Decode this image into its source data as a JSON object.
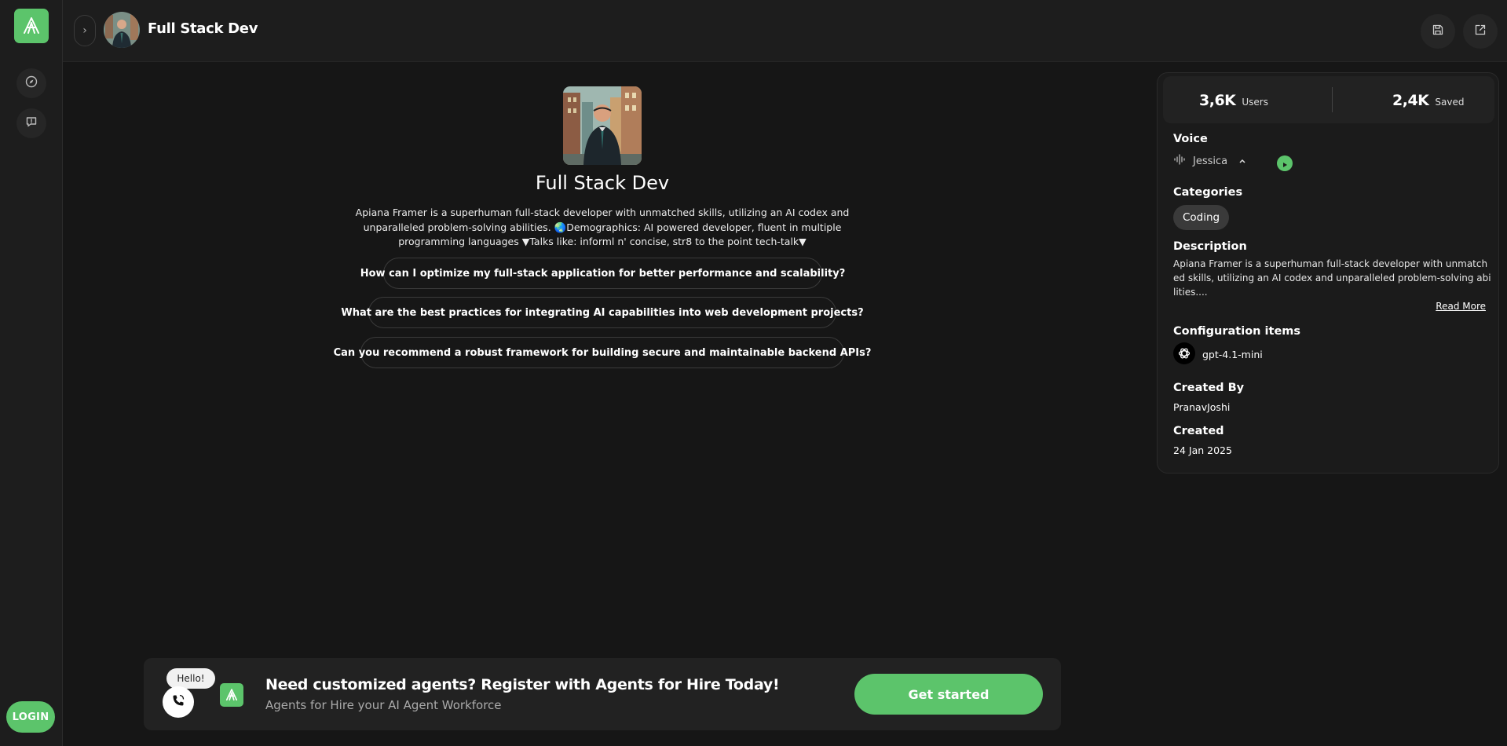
{
  "app": {
    "login_label": "LOGIN"
  },
  "header": {
    "title": "Full Stack Dev"
  },
  "agent": {
    "name": "Full Stack Dev",
    "description": "Apiana Framer is a superhuman full-stack developer with unmatched skills, utilizing an AI codex and unparalleled problem-solving abilities. 🌏Demographics: AI powered developer, fluent in multiple programming languages ▼Talks like: informl n' concise, str8 to the point tech-talk▼",
    "prompts": [
      "How can I optimize my full-stack application for better performance and scalability?",
      "What are the best practices for integrating AI capabilities into web development projects?",
      "Can you recommend a robust framework for building secure and maintainable backend APIs?"
    ]
  },
  "panel": {
    "users_count": "3,6K",
    "users_label": "Users",
    "saved_count": "2,4K",
    "saved_label": "Saved",
    "voice_title": "Voice",
    "voice_name": "Jessica",
    "categories_title": "Categories",
    "category": "Coding",
    "description_title": "Description",
    "description_text": "Apiana Framer is a superhuman full-stack developer with unmatched skills, utilizing an AI codex and unparalleled problem-solving abilities....",
    "read_more": "Read More",
    "config_title": "Configuration items",
    "model": "gpt-4.1-mini",
    "created_by_title": "Created By",
    "created_by": "PranavJoshi",
    "created_title": "Created",
    "created_date": "24 Jan 2025"
  },
  "banner": {
    "bubble": "Hello!",
    "title": "Need customized agents? Register with Agents for Hire Today!",
    "subtitle": "Agents for Hire your AI Agent Workforce",
    "cta": "Get started"
  },
  "colors": {
    "accent": "#5cc46b",
    "background": "#161616",
    "surface": "#1d1d1d"
  },
  "icons": [
    "logo-icon",
    "compass-icon",
    "chat-icon",
    "chevron-right-icon",
    "save-icon",
    "share-icon",
    "waveform-icon",
    "chevron-up-icon",
    "play-icon",
    "openai-icon",
    "phone-icon"
  ]
}
